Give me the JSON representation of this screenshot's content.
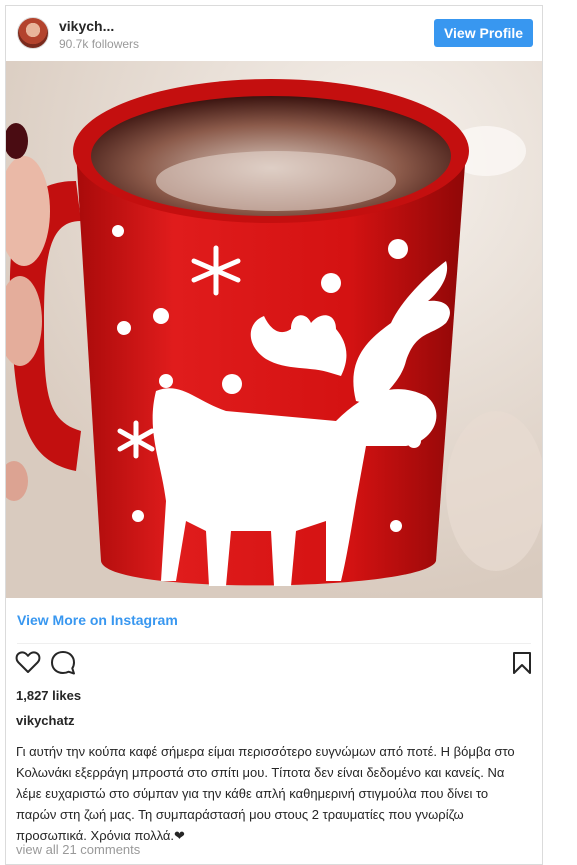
{
  "header": {
    "username": "vikych...",
    "followers": "90.7k followers",
    "view_profile_label": "View Profile"
  },
  "post": {
    "view_more_label": "View More on Instagram",
    "likes": "1,827 likes",
    "caption_user": "vikychatz",
    "caption_text": "Γι αυτήν την κούπα καφέ σήμερα είμαι περισσότερο ευγνώμων από ποτέ. Η βόμβα στο Κολωνάκι εξερράγη μπροστά στο σπίτι μου. Τίποτα δεν είναι δεδομένο και κανείς. Να λέμε ευχαριστώ στο σύμπαν για την κάθε απλή καθημερινή στιγμούλα που δίνει το παρών στη ζωή μας. Τη συμπαράστασή μου στους 2 τραυματίες που γνωρίζω προσωπικά. Χρόνια πολλά.❤",
    "comments_label": "view all 21 comments"
  },
  "icons": {
    "like": "heart-icon",
    "comment": "comment-icon",
    "save": "bookmark-icon"
  },
  "colors": {
    "accent": "#3897f0",
    "mug_red": "#d81414"
  }
}
